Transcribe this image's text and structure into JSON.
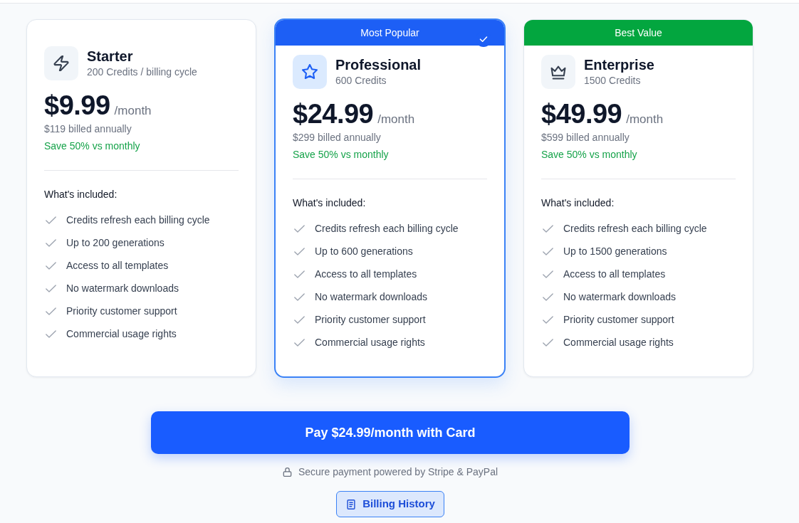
{
  "plans": [
    {
      "name": "Starter",
      "credits": "200 Credits / billing cycle",
      "price": "$9.99",
      "period": "/month",
      "billed": "$119 billed annually",
      "savings": "Save 50% vs monthly",
      "features_heading": "What's included:",
      "features": [
        "Credits refresh each billing cycle",
        "Up to 200 generations",
        "Access to all templates",
        "No watermark downloads",
        "Priority customer support",
        "Commercial usage rights"
      ],
      "selected": false
    },
    {
      "name": "Professional",
      "credits": "600 Credits",
      "price": "$24.99",
      "period": "/month",
      "billed": "$299 billed annually",
      "savings": "Save 50% vs monthly",
      "features_heading": "What's included:",
      "features": [
        "Credits refresh each billing cycle",
        "Up to 600 generations",
        "Access to all templates",
        "No watermark downloads",
        "Priority customer support",
        "Commercial usage rights"
      ],
      "badge": {
        "label": "Most Popular",
        "color": "#1d5ff5"
      },
      "selected": true
    },
    {
      "name": "Enterprise",
      "credits": "1500 Credits",
      "price": "$49.99",
      "period": "/month",
      "billed": "$599 billed annually",
      "savings": "Save 50% vs monthly",
      "features_heading": "What's included:",
      "features": [
        "Credits refresh each billing cycle",
        "Up to 1500 generations",
        "Access to all templates",
        "No watermark downloads",
        "Priority customer support",
        "Commercial usage rights"
      ],
      "badge": {
        "label": "Best Value",
        "color": "#03a63f"
      },
      "selected": false
    }
  ],
  "pay_button": "Pay $24.99/month with Card",
  "secure_note": "Secure payment powered by Stripe & PayPal",
  "history_button": "Billing History"
}
